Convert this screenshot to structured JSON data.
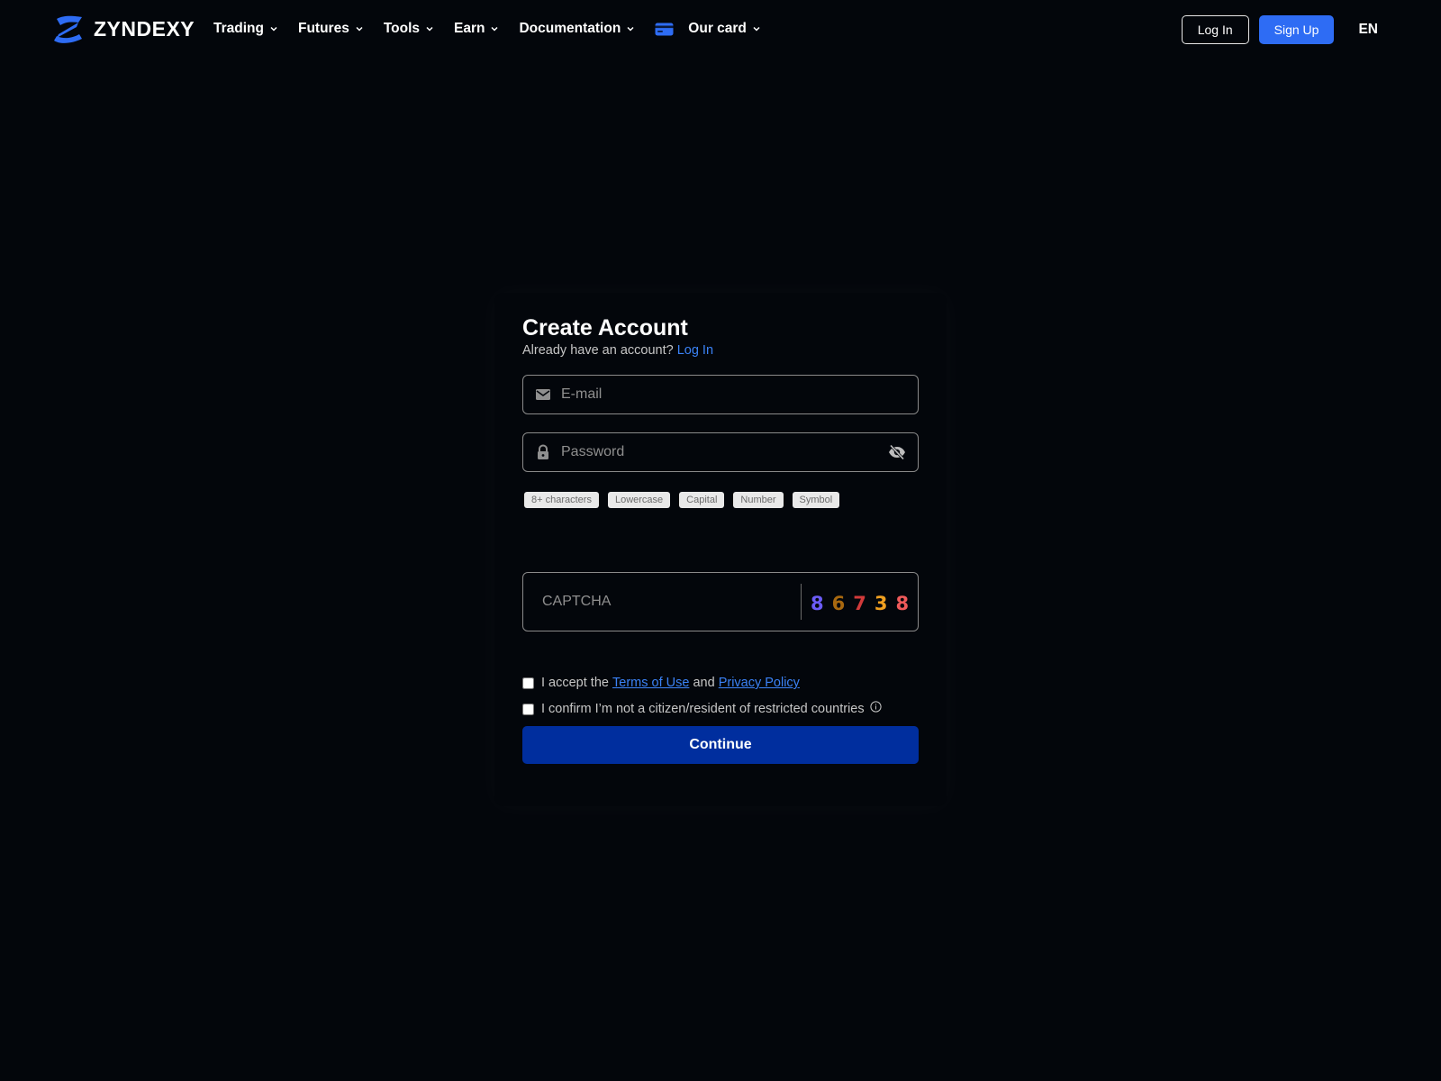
{
  "brand": {
    "name": "ZYNDEXY",
    "logo_icon": "z-logo-icon",
    "accent": "#2e6cf4"
  },
  "nav": {
    "items": [
      {
        "label": "Trading",
        "icon": "chevron-down-icon"
      },
      {
        "label": "Futures",
        "icon": "chevron-down-icon"
      },
      {
        "label": "Tools",
        "icon": "chevron-down-icon"
      },
      {
        "label": "Earn",
        "icon": "chevron-down-icon"
      },
      {
        "label": "Documentation",
        "icon": "chevron-down-icon"
      },
      {
        "label": "Our card",
        "icon": "credit-card-icon"
      }
    ]
  },
  "header": {
    "login_label": "Log In",
    "signup_label": "Sign Up",
    "language": "EN"
  },
  "form": {
    "title": "Create Account",
    "subtitle": "Already have an account?",
    "login_link": "Log In",
    "email": {
      "placeholder": "E-mail",
      "value": "",
      "icon": "mail-icon"
    },
    "password": {
      "placeholder": "Password",
      "value": "",
      "icon": "lock-icon",
      "toggle_icon": "eye-off-icon"
    },
    "requirements": [
      "8+ characters",
      "Lowercase",
      "Capital",
      "Number",
      "Symbol"
    ],
    "captcha": {
      "placeholder": "CAPTCHA",
      "value": "",
      "code": [
        {
          "char": "8",
          "color": "#6b5cf6"
        },
        {
          "char": "6",
          "color": "#a8680f"
        },
        {
          "char": "7",
          "color": "#d23a3a"
        },
        {
          "char": "3",
          "color": "#f0a020"
        },
        {
          "char": "8",
          "color": "#ef5a5a"
        }
      ]
    },
    "terms": {
      "prefix": "I accept the",
      "terms_link": "Terms of Use",
      "joiner": "and",
      "privacy_link": "Privacy Policy",
      "checked": false
    },
    "residency": {
      "label": "I confirm I’m not a citizen/resident of restricted countries",
      "checked": false,
      "icon": "info-icon"
    },
    "submit_label": "Continue",
    "submit_color": "#002e9e"
  }
}
